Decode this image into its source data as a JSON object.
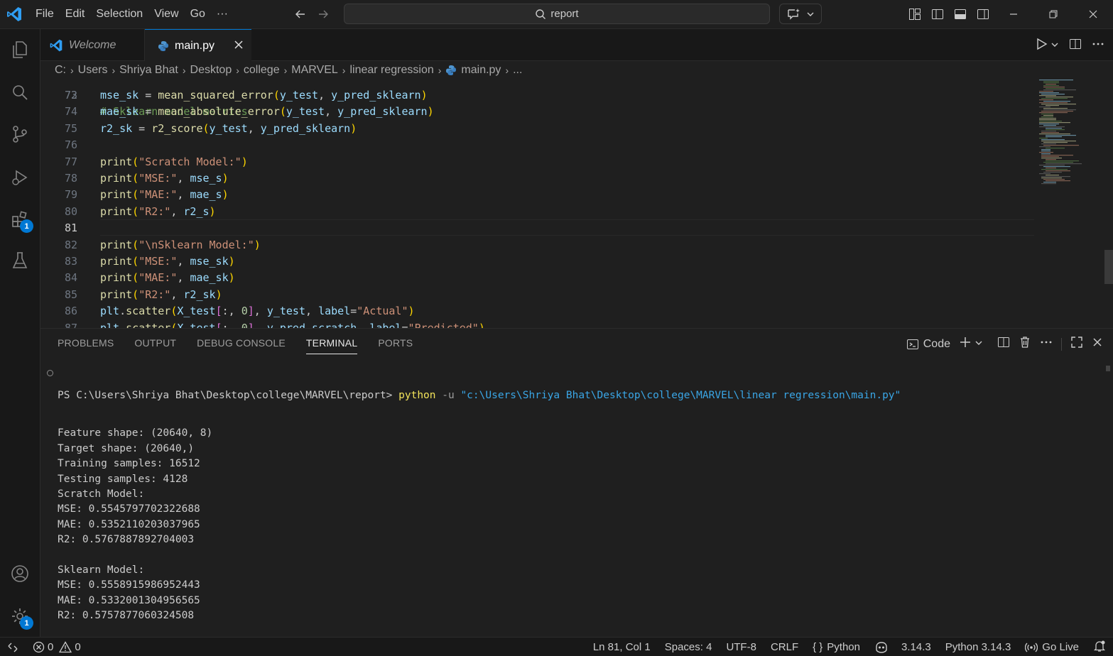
{
  "menu": [
    "File",
    "Edit",
    "Selection",
    "View",
    "Go",
    "···"
  ],
  "search": {
    "text": "report"
  },
  "tabs": [
    {
      "label": "Welcome"
    },
    {
      "label": "main.py"
    }
  ],
  "breadcrumb": [
    "C:",
    "Users",
    "Shriya Bhat",
    "Desktop",
    "college",
    "MARVEL",
    "linear regression",
    "main.py",
    "..."
  ],
  "activity_badges": {
    "extensions": "1",
    "settings": "1"
  },
  "editor": {
    "first_partial_line": "# Sklearn model metrics",
    "lines": [
      {
        "n": "73",
        "tokens": [
          [
            "var",
            "mse_sk"
          ],
          [
            "p",
            " = "
          ],
          [
            "fn",
            "mean_squared_error"
          ],
          [
            "p1",
            "("
          ],
          [
            "var",
            "y_test"
          ],
          [
            "p",
            ", "
          ],
          [
            "var",
            "y_pred_sklearn"
          ],
          [
            "p1",
            ")"
          ]
        ]
      },
      {
        "n": "74",
        "tokens": [
          [
            "var",
            "mae_sk"
          ],
          [
            "p",
            " = "
          ],
          [
            "fn",
            "mean_absolute_error"
          ],
          [
            "p1",
            "("
          ],
          [
            "var",
            "y_test"
          ],
          [
            "p",
            ", "
          ],
          [
            "var",
            "y_pred_sklearn"
          ],
          [
            "p1",
            ")"
          ]
        ]
      },
      {
        "n": "75",
        "tokens": [
          [
            "var",
            "r2_sk"
          ],
          [
            "p",
            " = "
          ],
          [
            "fn",
            "r2_score"
          ],
          [
            "p1",
            "("
          ],
          [
            "var",
            "y_test"
          ],
          [
            "p",
            ", "
          ],
          [
            "var",
            "y_pred_sklearn"
          ],
          [
            "p1",
            ")"
          ]
        ]
      },
      {
        "n": "76",
        "tokens": []
      },
      {
        "n": "77",
        "tokens": [
          [
            "fn",
            "print"
          ],
          [
            "p1",
            "("
          ],
          [
            "str",
            "\"Scratch Model:\""
          ],
          [
            "p1",
            ")"
          ]
        ]
      },
      {
        "n": "78",
        "tokens": [
          [
            "fn",
            "print"
          ],
          [
            "p1",
            "("
          ],
          [
            "str",
            "\"MSE:\""
          ],
          [
            "p",
            ", "
          ],
          [
            "var",
            "mse_s"
          ],
          [
            "p1",
            ")"
          ]
        ]
      },
      {
        "n": "79",
        "tokens": [
          [
            "fn",
            "print"
          ],
          [
            "p1",
            "("
          ],
          [
            "str",
            "\"MAE:\""
          ],
          [
            "p",
            ", "
          ],
          [
            "var",
            "mae_s"
          ],
          [
            "p1",
            ")"
          ]
        ]
      },
      {
        "n": "80",
        "tokens": [
          [
            "fn",
            "print"
          ],
          [
            "p1",
            "("
          ],
          [
            "str",
            "\"R2:\""
          ],
          [
            "p",
            ", "
          ],
          [
            "var",
            "r2_s"
          ],
          [
            "p1",
            ")"
          ]
        ]
      },
      {
        "n": "81",
        "tokens": [],
        "active": true
      },
      {
        "n": "82",
        "tokens": [
          [
            "fn",
            "print"
          ],
          [
            "p1",
            "("
          ],
          [
            "str",
            "\"\\nSklearn Model:\""
          ],
          [
            "p1",
            ")"
          ]
        ]
      },
      {
        "n": "83",
        "tokens": [
          [
            "fn",
            "print"
          ],
          [
            "p1",
            "("
          ],
          [
            "str",
            "\"MSE:\""
          ],
          [
            "p",
            ", "
          ],
          [
            "var",
            "mse_sk"
          ],
          [
            "p1",
            ")"
          ]
        ]
      },
      {
        "n": "84",
        "tokens": [
          [
            "fn",
            "print"
          ],
          [
            "p1",
            "("
          ],
          [
            "str",
            "\"MAE:\""
          ],
          [
            "p",
            ", "
          ],
          [
            "var",
            "mae_sk"
          ],
          [
            "p1",
            ")"
          ]
        ]
      },
      {
        "n": "85",
        "tokens": [
          [
            "fn",
            "print"
          ],
          [
            "p1",
            "("
          ],
          [
            "str",
            "\"R2:\""
          ],
          [
            "p",
            ", "
          ],
          [
            "var",
            "r2_sk"
          ],
          [
            "p1",
            ")"
          ]
        ]
      },
      {
        "n": "86",
        "tokens": [
          [
            "var",
            "plt"
          ],
          [
            "p",
            "."
          ],
          [
            "fn",
            "scatter"
          ],
          [
            "p1",
            "("
          ],
          [
            "var",
            "X_test"
          ],
          [
            "p2",
            "["
          ],
          [
            "p",
            ":, "
          ],
          [
            "num",
            "0"
          ],
          [
            "p2",
            "]"
          ],
          [
            "p",
            ", "
          ],
          [
            "var",
            "y_test"
          ],
          [
            "p",
            ", "
          ],
          [
            "var",
            "label"
          ],
          [
            "p",
            "="
          ],
          [
            "str",
            "\"Actual\""
          ],
          [
            "p1",
            ")"
          ]
        ]
      },
      {
        "n": "87",
        "tokens": [
          [
            "var",
            "plt"
          ],
          [
            "p",
            "."
          ],
          [
            "fn",
            "scatter"
          ],
          [
            "p1",
            "("
          ],
          [
            "var",
            "X_test"
          ],
          [
            "p2",
            "["
          ],
          [
            "p",
            ":, "
          ],
          [
            "num",
            "0"
          ],
          [
            "p2",
            "]"
          ],
          [
            "p",
            ", "
          ],
          [
            "var",
            "y_pred_scratch"
          ],
          [
            "p",
            ", "
          ],
          [
            "var",
            "label"
          ],
          [
            "p",
            "="
          ],
          [
            "str",
            "\"Predicted\""
          ],
          [
            "p1",
            ")"
          ]
        ]
      }
    ]
  },
  "panel": {
    "tabs": [
      "PROBLEMS",
      "OUTPUT",
      "DEBUG CONSOLE",
      "TERMINAL",
      "PORTS"
    ],
    "active_tab": "TERMINAL",
    "terminal_profile": "Code",
    "prompt": "PS C:\\Users\\Shriya Bhat\\Desktop\\college\\MARVEL\\report> ",
    "command": "python",
    "flag": " -u ",
    "script_path": "\"c:\\Users\\Shriya Bhat\\Desktop\\college\\MARVEL\\linear regression\\main.py\"",
    "output": [
      "Feature shape: (20640, 8)",
      "Target shape: (20640,)",
      "Training samples: 16512",
      "Testing samples: 4128",
      "Scratch Model:",
      "MSE: 0.5545797702322688",
      "MAE: 0.5352110203037965",
      "R2: 0.5767887892704003",
      "",
      "Sklearn Model:",
      "MSE: 0.5558915986952443",
      "MAE: 0.5332001304956565",
      "R2: 0.5757877060324508"
    ]
  },
  "status": {
    "errors": "0",
    "warnings": "0",
    "position": "Ln 81, Col 1",
    "spaces": "Spaces: 4",
    "encoding": "UTF-8",
    "eol": "CRLF",
    "language": "Python",
    "version": "3.14.3",
    "interpreter": "Python 3.14.3",
    "golive": "Go Live"
  },
  "colors": {
    "accent": "#0078d4",
    "background": "#1f1f1f",
    "sidebar": "#181818"
  }
}
